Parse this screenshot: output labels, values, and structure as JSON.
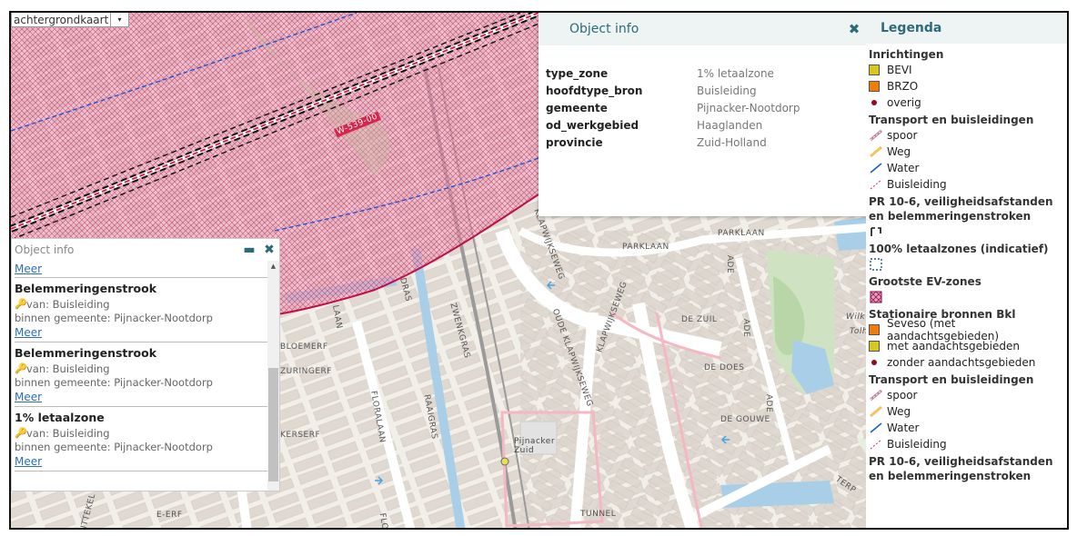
{
  "basemap": {
    "label": "achtergrondkaart",
    "arrow": "▾"
  },
  "map_labels": {
    "parklaan": "PARKLAAN",
    "parklaan2": "PARKLAAN",
    "ade": "ADE",
    "ade2": "ADE",
    "ade3": "ADE",
    "dezuil": "DE ZUIL",
    "dedoes": "DE DOES",
    "degouwe": "DE GOUWE",
    "klapwijkseweg": "KLAPWIJKSEWEG",
    "klapwijkseweg2": "KLAPWIJKSEWEG",
    "oudeklapwijkseweg": "OUDE KLAPWIJKSEWEG",
    "pijnacker": "Pijnacker\nZuid",
    "zwenkgras": "ZWENKGRAS",
    "floralaan": "FLORALAAN",
    "raaigras": "RAAIGRAS",
    "buisleiding": "W-539-00",
    "tunnel": "TUNNEL",
    "flo": "FLO",
    "terp": "TERP",
    "bloemerf": "BLOEMERF",
    "zuringerf": "ZURINGERF",
    "kerserf": "KERSERF",
    "witerf": "WITTEKEL",
    "erf": "E-ERF",
    "dras": "DRAS",
    "laan": "LAAN",
    "wilk": "Wilk",
    "tolh": "Tolh"
  },
  "popup": {
    "title": "Object info",
    "close_icon": "✖",
    "rows": [
      {
        "key": "type_zone",
        "value": "1% letaalzone"
      },
      {
        "key": "hoofdtype_bron",
        "value": "Buisleiding"
      },
      {
        "key": "gemeente",
        "value": "Pijnacker-Nootdorp"
      },
      {
        "key": "od_werkgebied",
        "value": "Haaglanden"
      },
      {
        "key": "provincie",
        "value": "Zuid-Holland"
      }
    ]
  },
  "list_panel": {
    "title": "Object info",
    "minimize_icon": "▬",
    "close_icon": "✖",
    "scroll_up": "▲",
    "first_link": "Meer",
    "items": [
      {
        "name": "Belemmeringenstrook",
        "source": "van: Buisleiding",
        "municipality": "binnen gemeente: Pijnacker-Nootdorp",
        "link": "Meer"
      },
      {
        "name": "Belemmeringenstrook",
        "source": "van: Buisleiding",
        "municipality": "binnen gemeente: Pijnacker-Nootdorp",
        "link": "Meer"
      },
      {
        "name": "1% letaalzone",
        "source": "van: Buisleiding",
        "municipality": "binnen gemeente: Pijnacker-Nootdorp",
        "link": "Meer"
      }
    ]
  },
  "legend": {
    "title": "Legenda",
    "sections": {
      "inrichtingen": "Inrichtingen",
      "transport1": "Transport en buisleidingen",
      "pr": "PR 10-6, veiligheidsafstanden en belemmeringenstroken",
      "letaal100": "100% letaalzones (indicatief)",
      "ev": "Grootste EV-zones",
      "stationaire": "Stationaire bronnen Bkl",
      "transport2": "Transport en buisleidingen",
      "pr2": "PR 10-6, veiligheidsafstanden en belemmeringenstroken"
    },
    "items": {
      "bevi": "BEVI",
      "brzo": "BRZO",
      "overig": "overig",
      "spoor": "spoor",
      "weg": "Weg",
      "water": "Water",
      "buisleiding": "Buisleiding",
      "seveso": "Seveso (met aandachtsgebieden)",
      "met": "met aandachtsgebieden",
      "zonder": "zonder aandachtsgebieden",
      "spoor2": "spoor",
      "weg2": "Weg",
      "water2": "Water",
      "buisleiding2": "Buisleiding"
    },
    "colors": {
      "bevi": "#d8c623",
      "brzo": "#f07c0c",
      "overig": "#8b0e22",
      "water": "#1a5fd0",
      "weg": "#f5c060",
      "zone_fill": "#e8a0b8",
      "zone_line": "#c0104a"
    }
  }
}
